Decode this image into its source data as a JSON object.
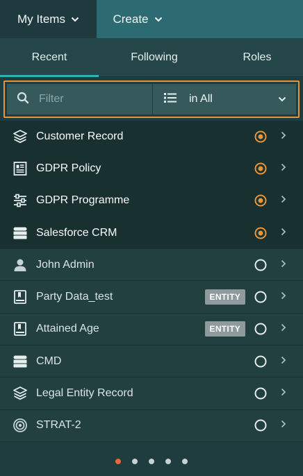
{
  "topbar": {
    "my_items_label": "My Items",
    "create_label": "Create"
  },
  "subtabs": [
    "Recent",
    "Following",
    "Roles"
  ],
  "filter": {
    "placeholder": "Filter",
    "scope_label": "in All"
  },
  "colors": {
    "accent_orange": "#e8953a",
    "accent_teal": "#2bb3b8",
    "active_dot": "#e9683b"
  },
  "items": [
    {
      "label": "Customer Record",
      "icon": "layers-icon",
      "status": "active",
      "badge": ""
    },
    {
      "label": "GDPR Policy",
      "icon": "policy-document-icon",
      "status": "active",
      "badge": ""
    },
    {
      "label": "GDPR Programme",
      "icon": "sliders-icon",
      "status": "active",
      "badge": ""
    },
    {
      "label": "Salesforce CRM",
      "icon": "database-server-icon",
      "status": "active",
      "badge": ""
    },
    {
      "label": "John Admin",
      "icon": "user-icon",
      "status": "inactive",
      "badge": ""
    },
    {
      "label": "Party Data_test",
      "icon": "book-icon",
      "status": "inactive",
      "badge": "ENTITY"
    },
    {
      "label": "Attained Age",
      "icon": "book-icon",
      "status": "inactive",
      "badge": "ENTITY"
    },
    {
      "label": "CMD",
      "icon": "database-server-icon",
      "status": "inactive",
      "badge": ""
    },
    {
      "label": "Legal Entity Record",
      "icon": "layers-icon",
      "status": "inactive",
      "badge": ""
    },
    {
      "label": "STRAT-2",
      "icon": "target-icon",
      "status": "inactive",
      "badge": ""
    }
  ],
  "pagination": {
    "pages": 5,
    "current": 1
  }
}
